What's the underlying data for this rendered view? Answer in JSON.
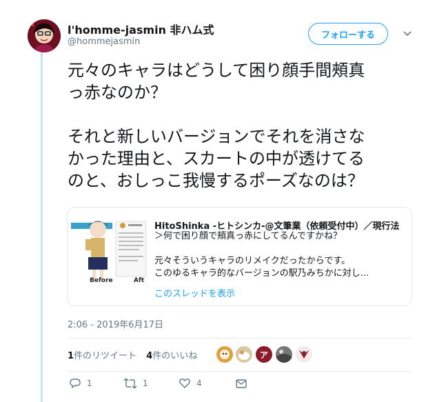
{
  "author": {
    "display_name": "l'homme-jasmin 非ハム式",
    "handle": "@hommejasmin"
  },
  "follow_label": "フォローする",
  "tweet_text": "元々のキャラはどうして困り顔手間頰真\nっ赤なのか？\n\nそれと新しいバージョンでそれを消さな\nかった理由と、スカートの中が透けてる\nのと、おしっこ我慢するポーズなのは？",
  "quoted": {
    "image_label_before": "Before",
    "image_label_after": "Aft",
    "title": "HitoShinka -ヒトシンカ-@文筆業（依頼受付中）／現行法",
    "line1": "＞何で困り顔で頬真っ赤にしてるんですかね？",
    "line2": "元々そういうキャラのリメイクだったからです。",
    "line3": "このゆるキャラ的なバージョンの駅乃みちかに対し...",
    "show_thread": "このスレッドを表示"
  },
  "timestamp": "2:06 - 2019年6月17日",
  "stats": {
    "retweets_count": "1",
    "retweets_label": "件のリツイート",
    "likes_count": "4",
    "likes_label": "件のいいね"
  },
  "likers": [
    "avatar-1",
    "avatar-2",
    "avatar-3",
    "avatar-4",
    "avatar-5"
  ],
  "actions": {
    "reply_count": "1",
    "retweet_count": "1",
    "like_count": "4"
  },
  "colors": {
    "accent": "#1da1f2",
    "muted": "#657786",
    "thread_line": "#c4e4f6"
  }
}
